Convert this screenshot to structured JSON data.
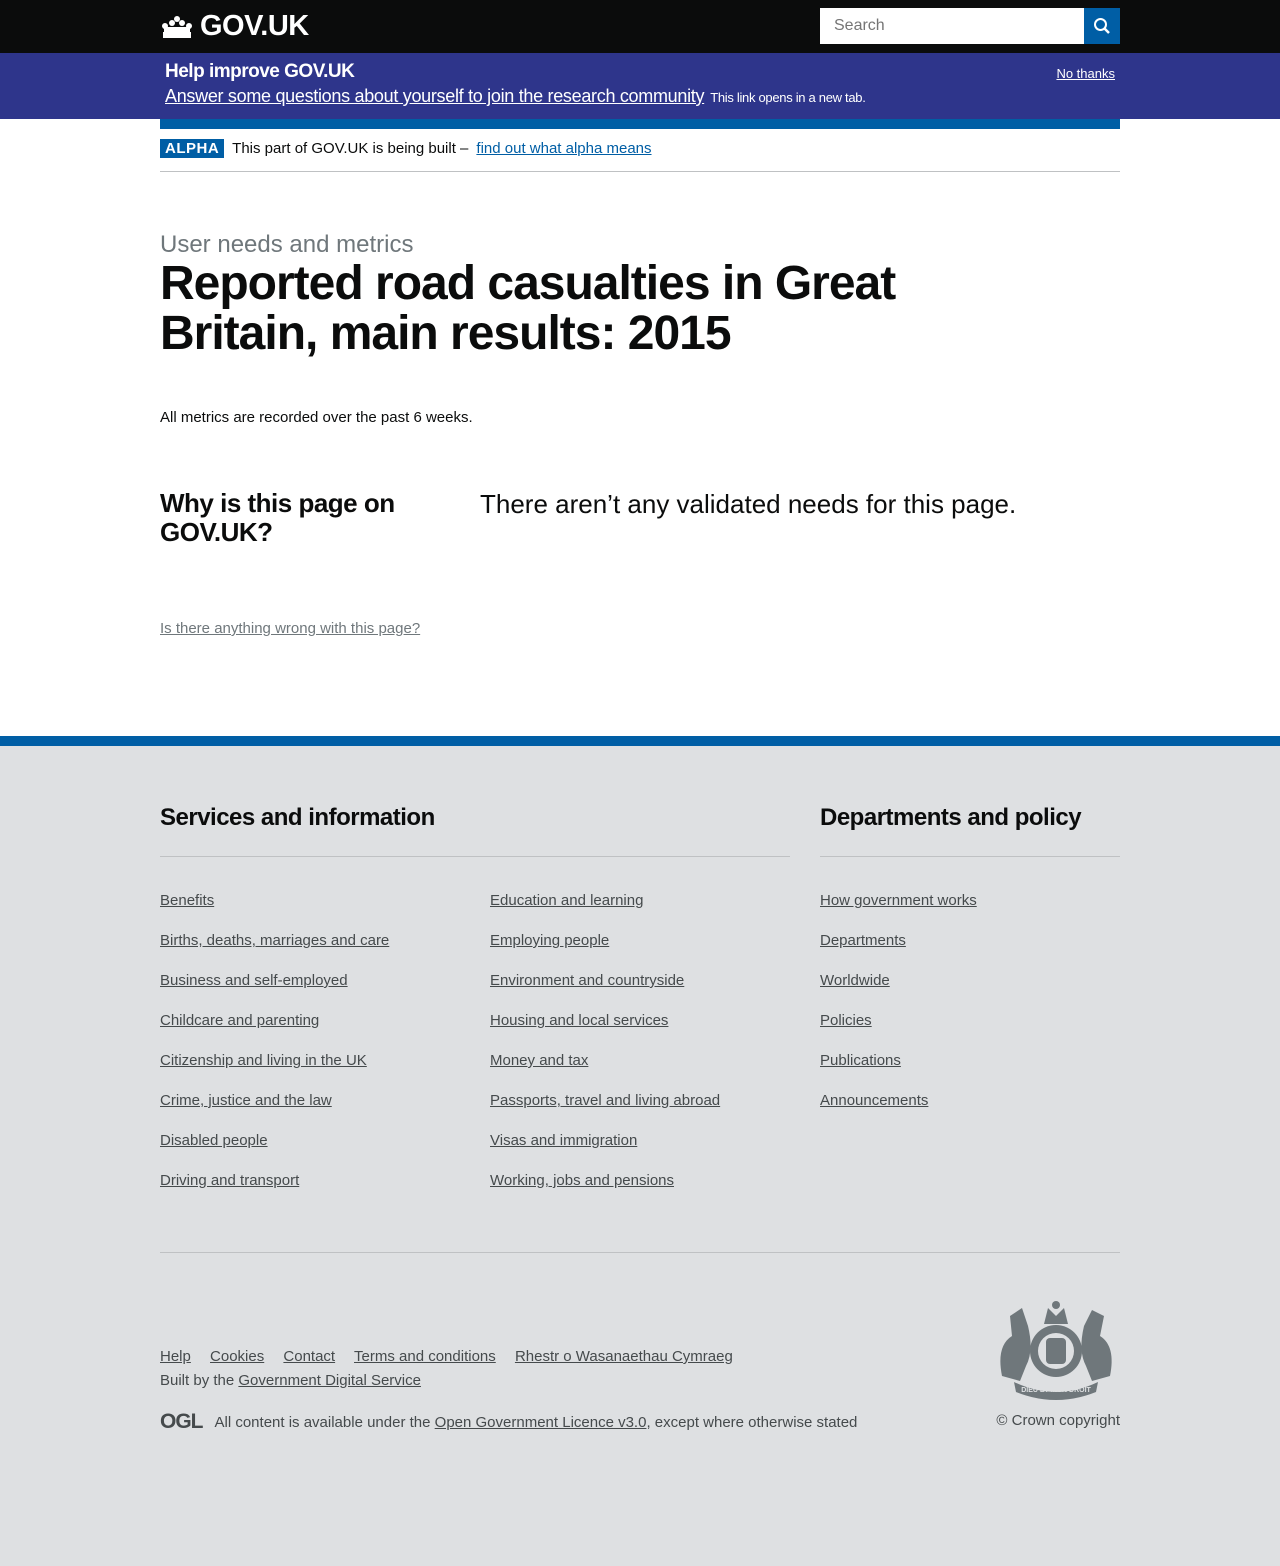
{
  "header": {
    "logo": "GOV.UK",
    "search_placeholder": "Search"
  },
  "banner": {
    "title": "Help improve GOV.UK",
    "link": "Answer some questions about yourself to join the research community",
    "note": "This link opens in a new tab.",
    "dismiss": "No thanks"
  },
  "phase": {
    "tag": "ALPHA",
    "text": "This part of GOV.UK is being built –",
    "link": "find out what alpha means"
  },
  "page": {
    "caption": "User needs and metrics",
    "title": "Reported road casualties in Great Britain, main results: 2015",
    "metrics_note": "All metrics are recorded over the past 6 weeks.",
    "why_heading": "Why is this page on GOV.UK?",
    "needs_text": "There aren’t any validated needs for this page.",
    "report_link": "Is there anything wrong with this page?"
  },
  "footer": {
    "services_heading": "Services and information",
    "departments_heading": "Departments and policy",
    "services_col1": [
      "Benefits",
      "Births, deaths, marriages and care",
      "Business and self-employed",
      "Childcare and parenting",
      "Citizenship and living in the UK",
      "Crime, justice and the law",
      "Disabled people",
      "Driving and transport"
    ],
    "services_col2": [
      "Education and learning",
      "Employing people",
      "Environment and countryside",
      "Housing and local services",
      "Money and tax",
      "Passports, travel and living abroad",
      "Visas and immigration",
      "Working, jobs and pensions"
    ],
    "departments": [
      "How government works",
      "Departments",
      "Worldwide",
      "Policies",
      "Publications",
      "Announcements"
    ],
    "meta_links": [
      "Help",
      "Cookies",
      "Contact",
      "Terms and conditions",
      "Rhestr o Wasanaethau Cymraeg"
    ],
    "built_prefix": "Built by the",
    "built_link": "Government Digital Service",
    "ogl": "OGL",
    "licence_prefix": "All content is available under the",
    "licence_link": "Open Government Licence v3.0",
    "licence_suffix": ", except where otherwise stated",
    "copyright": "© Crown copyright",
    "crest_text": "DIEU ET MON DROIT"
  }
}
